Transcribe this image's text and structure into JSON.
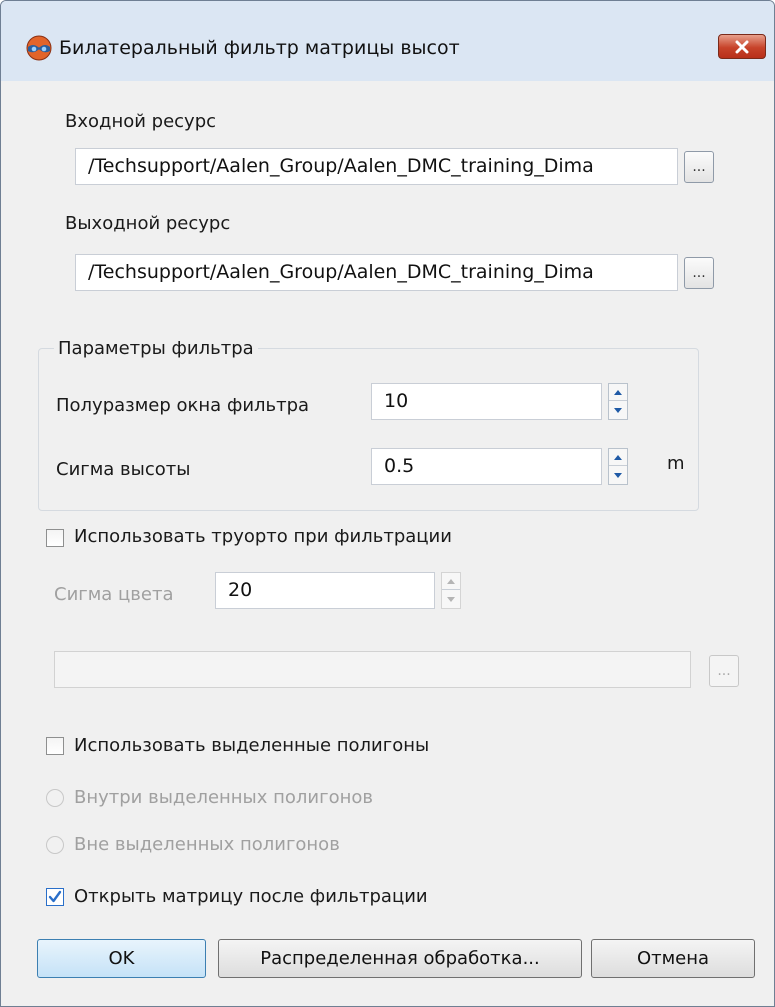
{
  "window": {
    "title": "Билатеральный фильтр матрицы высот"
  },
  "input_resource": {
    "label": "Входной ресурс",
    "value": "/Techsupport/Aalen_Group/Aalen_DMC_training_Dima",
    "browse_label": "..."
  },
  "output_resource": {
    "label": "Выходной ресурс",
    "value": "/Techsupport/Aalen_Group/Aalen_DMC_training_Dima",
    "browse_label": "..."
  },
  "filter_params": {
    "legend": "Параметры фильтра",
    "half_window_label": "Полуразмер окна фильтра",
    "half_window_value": "10",
    "height_sigma_label": "Сигма высоты",
    "height_sigma_value": "0.5",
    "height_sigma_unit": "m"
  },
  "trueortho": {
    "checkbox_label": "Использовать труорто при фильтрации",
    "checked": false,
    "color_sigma_label": "Сигма цвета",
    "color_sigma_value": "20",
    "path_value": "",
    "browse_label": "..."
  },
  "polygons": {
    "checkbox_label": "Использовать выделенные полигоны",
    "checked": false,
    "inside_label": "Внутри выделенных полигонов",
    "outside_label": "Вне выделенных полигонов"
  },
  "open_after": {
    "checkbox_label": "Открыть матрицу после фильтрации",
    "checked": true
  },
  "buttons": {
    "ok": "OK",
    "distributed": "Распределенная обработка...",
    "cancel": "Отмена"
  },
  "colors": {
    "titlebar": "#dbe6f3",
    "close_button": "#c7432a",
    "checkbox_checked": "#2a6fc9"
  }
}
